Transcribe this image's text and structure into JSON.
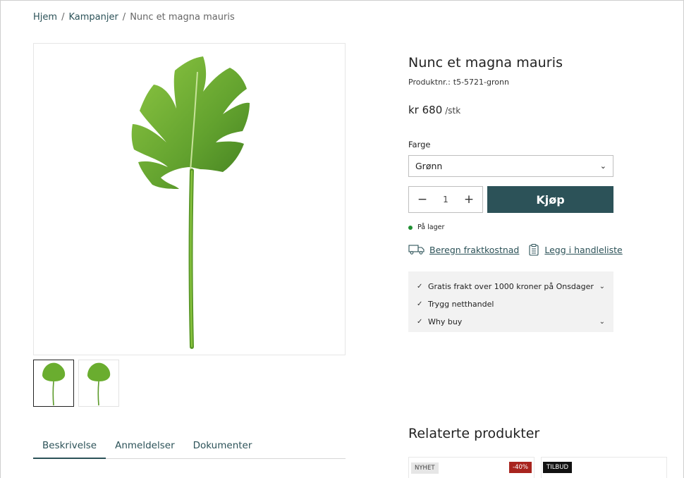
{
  "breadcrumb": {
    "items": [
      "Hjem",
      "Kampanjer"
    ],
    "separator": "/",
    "current": "Nunc et magna mauris"
  },
  "product": {
    "title": "Nunc et magna mauris",
    "sku_label": "Produktnr.:",
    "sku_value": "t5-5721-gronn",
    "price": "kr 680",
    "price_unit": "/stk",
    "color_label": "Farge",
    "color_selected": "Grønn",
    "quantity": "1",
    "buy_label": "Kjøp",
    "stock_text": "På lager",
    "stock_color": "#1f8f32"
  },
  "links": {
    "freight": "Beregn fraktkostnad",
    "shopping_list": "Legg i handleliste"
  },
  "usp": [
    {
      "text": "Gratis frakt over 1000 kroner på Onsdager",
      "expandable": true
    },
    {
      "text": "Trygg netthandel",
      "expandable": false
    },
    {
      "text": "Why buy",
      "expandable": true
    }
  ],
  "tabs": [
    "Beskrivelse",
    "Anmeldelser",
    "Dokumenter"
  ],
  "related": {
    "title": "Relaterte produkter",
    "cards": [
      {
        "badge_left": "NYHET",
        "badge_right": "-40%"
      },
      {
        "badge_left": "TILBUD"
      }
    ]
  },
  "colors": {
    "accent": "#2c5258",
    "discount": "#a8241e"
  }
}
